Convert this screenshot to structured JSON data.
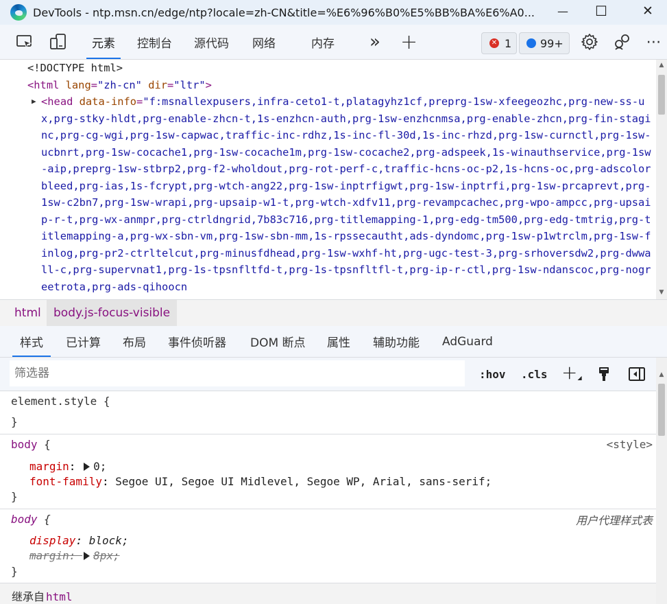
{
  "window": {
    "title": "DevTools - ntp.msn.cn/edge/ntp?locale=zh-CN&title=%E6%96%B0%E5%BB%BA%E6%A0...",
    "minimize_glyph": "—",
    "maximize_glyph": "☐",
    "close_glyph": "✕"
  },
  "toolbar": {
    "tabs": [
      {
        "label": "元素",
        "active": true
      },
      {
        "label": "控制台"
      },
      {
        "label": "源代码"
      },
      {
        "label": "网络"
      },
      {
        "label": "内存"
      }
    ],
    "more_tabs_glyph": "»",
    "add_tab_glyph": "+",
    "errors_count": "1",
    "issues_count": "99+",
    "icons": [
      "inspect-element-icon",
      "device-toolbar-icon",
      "gear-icon",
      "customize-icon",
      "more-icon"
    ]
  },
  "dom": {
    "doctype": "<!DOCTYPE html>",
    "html_open": {
      "tag": "html",
      "attrs": [
        {
          "name": "lang",
          "value": "zh-cn"
        },
        {
          "name": "dir",
          "value": "ltr"
        }
      ]
    },
    "head_tag": "head",
    "head_attr": "data-info",
    "head_value": "f:msnallexpusers,infra-ceto1-t,platagyhz1cf,preprg-1sw-xfeegeozhc,prg-new-ss-ux,prg-stky-hldt,prg-enable-zhcn-t,1s-enzhcn-auth,prg-1sw-enzhcnmsa,prg-enable-zhcn,prg-fin-staginc,prg-cg-wgi,prg-1sw-capwac,traffic-inc-rdhz,1s-inc-fl-30d,1s-inc-rhzd,prg-1sw-curnctl,prg-1sw-ucbnrt,prg-1sw-cocache1,prg-1sw-cocache1m,prg-1sw-cocache2,prg-adspeek,1s-winauthservice,prg-1sw-aip,preprg-1sw-stbrp2,prg-f2-wholdout,prg-rot-perf-c,traffic-hcns-oc-p2,1s-hcns-oc,prg-adscolorbleed,prg-ias,1s-fcrypt,prg-wtch-ang22,prg-1sw-inptrfigwt,prg-1sw-inptrfi,prg-1sw-prcaprevt,prg-1sw-c2bn7,prg-1sw-wrapi,prg-upsaip-w1-t,prg-wtch-xdfv11,prg-revampcachec,prg-wpo-ampcc,prg-upsaip-r-t,prg-wx-anmpr,prg-ctrldngrid,7b83c716,prg-titlemapping-1,prg-edg-tm500,prg-edg-tmtrig,prg-titlemapping-a,prg-wx-sbn-vm,prg-1sw-sbn-mm,1s-rpssecautht,ads-dyndomc,prg-1sw-p1wtrclm,prg-1sw-finlog,prg-pr2-ctrltelcut,prg-minusfdhead,prg-1sw-wxhf-ht,prg-ugc-test-3,prg-srhoversdw2,prg-dwwall-c,prg-supervnat1,prg-1s-tpsnfltfd-t,prg-1s-tpsnfltfl-t,prg-ip-r-ctl,prg-1sw-ndanscoc,prg-nogreetrota,prg-ads-qihoocn"
  },
  "breadcrumbs": [
    {
      "label": "html"
    },
    {
      "label": "body.js-focus-visible",
      "selected": true
    }
  ],
  "styles_tabs": [
    {
      "label": "样式",
      "active": true
    },
    {
      "label": "已计算"
    },
    {
      "label": "布局"
    },
    {
      "label": "事件侦听器"
    },
    {
      "label": "DOM 断点"
    },
    {
      "label": "属性"
    },
    {
      "label": "辅助功能"
    },
    {
      "label": "AdGuard"
    }
  ],
  "filter": {
    "placeholder": "筛选器",
    "hov_label": ":hov",
    "cls_label": ".cls",
    "add_rule_glyph": "+"
  },
  "rules": {
    "element_style": {
      "selector": "element.style",
      "open": "{",
      "close": "}"
    },
    "body_author": {
      "selector": "body",
      "open": "{",
      "close": "}",
      "origin": "<style>",
      "props": [
        {
          "name": "margin",
          "value": "0;"
        },
        {
          "name": "font-family",
          "value": "Segoe UI, Segoe UI Midlevel, Segoe WP, Arial, sans-serif;"
        }
      ]
    },
    "body_ua": {
      "selector": "body",
      "open": "{",
      "close": "}",
      "origin": "用户代理样式表",
      "props": [
        {
          "name": "display",
          "value": "block;"
        },
        {
          "name": "margin",
          "value": "8px;"
        }
      ]
    },
    "inherited": {
      "label": "继承自",
      "element": "html"
    }
  },
  "colors": {
    "accent": "#1a73e8",
    "tag": "#881280",
    "attr_name": "#994500",
    "attr_value": "#1a1aa6",
    "prop_name": "#c80000",
    "error": "#d93025"
  }
}
